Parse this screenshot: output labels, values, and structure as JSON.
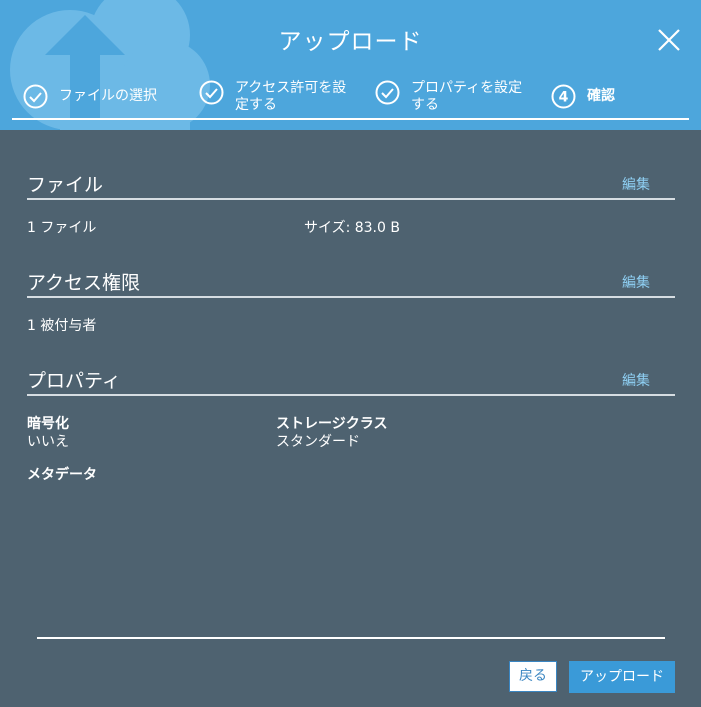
{
  "dialog": {
    "title": "アップロード",
    "colors": {
      "header": "#4da6dc",
      "body": "#4e6270",
      "link": "#8fd0f4",
      "primary_button": "#3a9ad8"
    }
  },
  "steps": [
    {
      "label": "ファイルの選択",
      "state": "done",
      "icon": "check-circle-icon"
    },
    {
      "label_line1": "アクセス許可を設",
      "label_line2": "定する",
      "state": "done",
      "icon": "check-circle-icon"
    },
    {
      "label_line1": "プロパティを設定",
      "label_line2": "する",
      "state": "done",
      "icon": "check-circle-icon"
    },
    {
      "number": "4",
      "label": "確認",
      "state": "current"
    }
  ],
  "sections": {
    "files": {
      "title": "ファイル",
      "edit": "編集",
      "count": "1 ファイル",
      "size": "サイズ: 83.0 B"
    },
    "permissions": {
      "title": "アクセス権限",
      "edit": "編集",
      "grantees": "1 被付与者"
    },
    "properties": {
      "title": "プロパティ",
      "edit": "編集",
      "encryption_label": "暗号化",
      "encryption_value": "いいえ",
      "storage_class_label": "ストレージクラス",
      "storage_class_value": "スタンダード",
      "metadata_label": "メタデータ"
    }
  },
  "footer": {
    "back": "戻る",
    "upload": "アップロード"
  }
}
